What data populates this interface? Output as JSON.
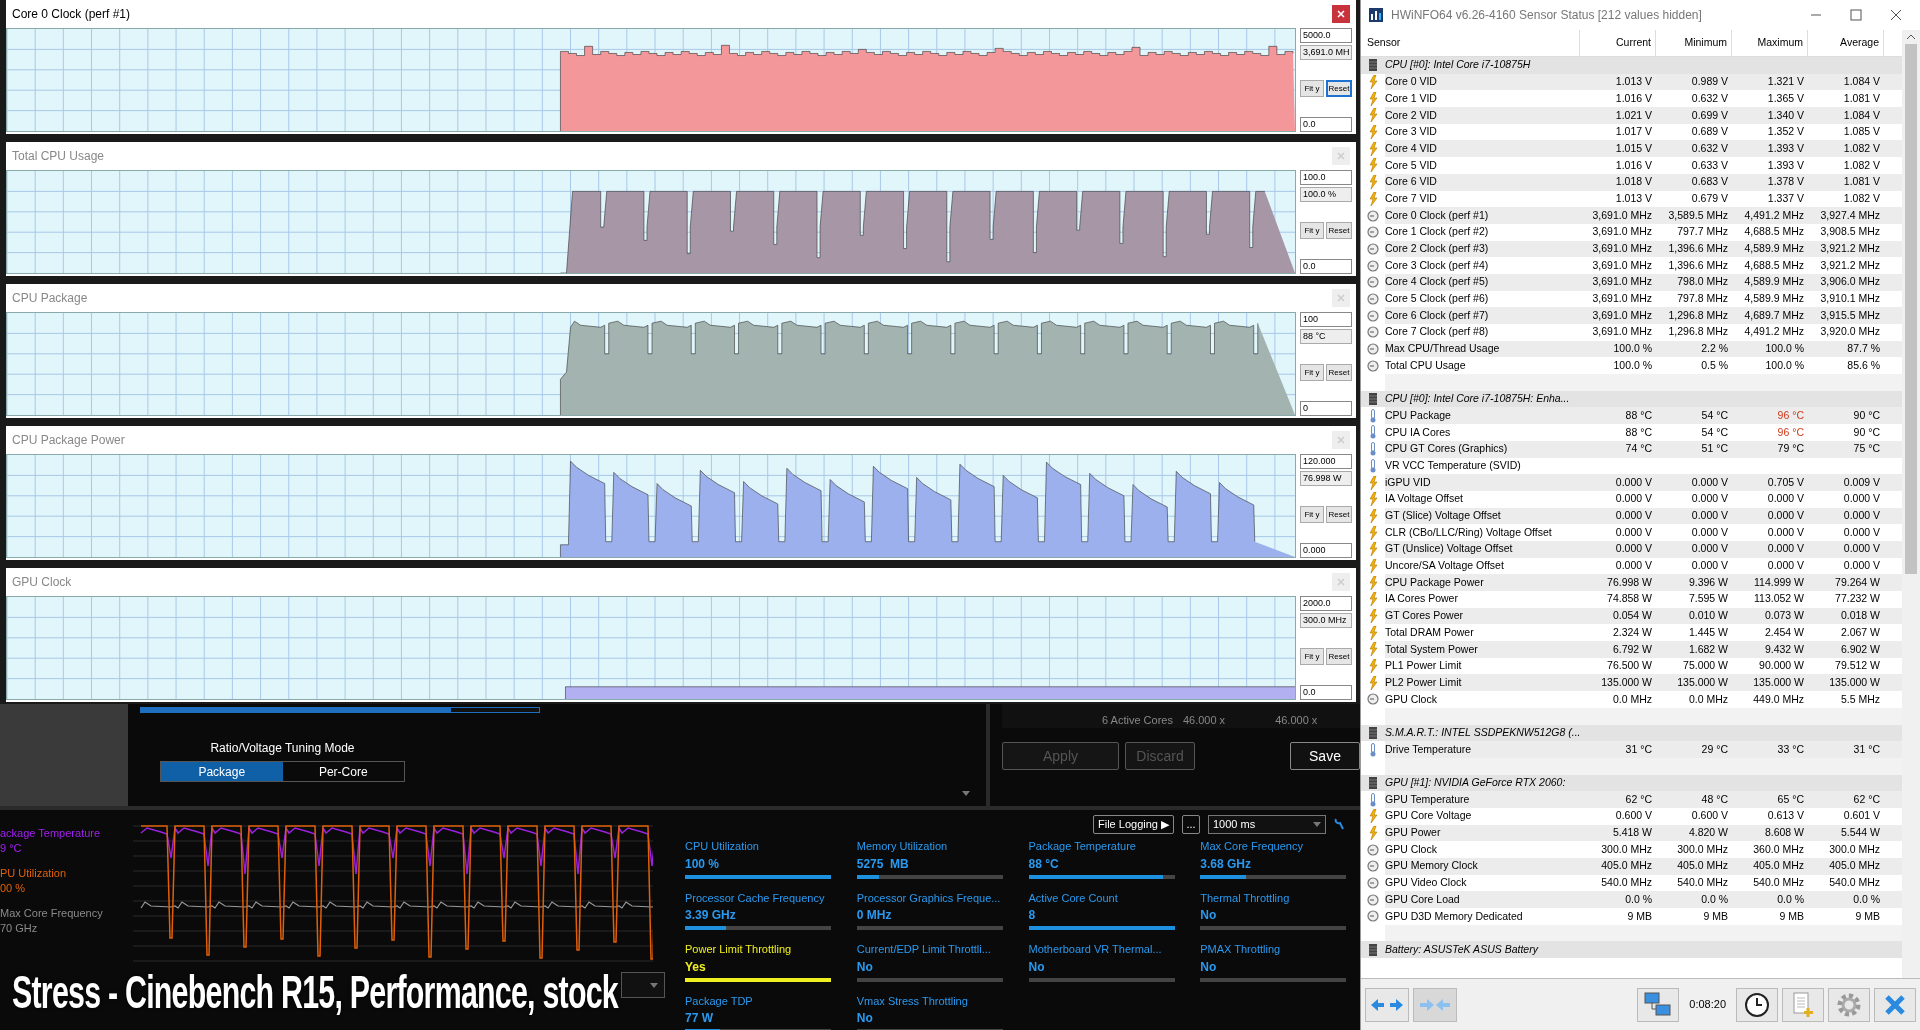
{
  "graph_windows": [
    {
      "title": "Core 0 Clock (perf #1)",
      "kind": "steady",
      "color": "#f4979a",
      "max": "5000.0",
      "reading": "3,691.0 MH",
      "min": "0.0",
      "active": true,
      "fit_label": "Fit y",
      "reset_label": "Reset"
    },
    {
      "title": "Total CPU Usage",
      "kind": "square",
      "color": "#a797a6",
      "max": "100.0",
      "reading": "100.0 %",
      "min": "0.0",
      "active": false,
      "fit_label": "Fit y",
      "reset_label": "Reset"
    },
    {
      "title": "CPU Package",
      "kind": "plateau",
      "color": "#a3b3b0",
      "max": "100",
      "reading": "88 °C",
      "min": "0",
      "active": false,
      "fit_label": "Fit y",
      "reset_label": "Reset"
    },
    {
      "title": "CPU Package Power",
      "kind": "saw",
      "color": "#9cb0ee",
      "max": "120.000",
      "reading": "76.998 W",
      "min": "0.000",
      "active": false,
      "fit_label": "Fit y",
      "reset_label": "Reset"
    },
    {
      "title": "GPU Clock",
      "kind": "flat",
      "color": "#b2b0f0",
      "max": "2000.0",
      "reading": "300.0 MHz",
      "min": "0.0",
      "active": false,
      "fit_label": "Fit y",
      "reset_label": "Reset"
    }
  ],
  "xtu": {
    "progress": {
      "level": 0.78
    },
    "tuning_mode": {
      "label": "Ratio/Voltage Tuning Mode",
      "options": [
        {
          "label": "Package",
          "selected": true
        },
        {
          "label": "Per-Core",
          "selected": false
        }
      ]
    },
    "active_cores": {
      "label": "6 Active Cores",
      "values": [
        "46.000 x",
        "46.000 x"
      ]
    },
    "buttons": [
      {
        "label": "Apply",
        "disabled": true
      },
      {
        "label": "Discard",
        "disabled": true
      },
      {
        "label": "Save",
        "disabled": false
      }
    ],
    "legend": [
      {
        "label": "ackage Temperature",
        "value": "9 °C",
        "color": "#a020f0"
      },
      {
        "label": "PU Utilization",
        "value": "00 %",
        "color": "#e0600a"
      },
      {
        "label": "Max Core Frequency",
        "value": "70 GHz",
        "color": "#8a8a8a"
      }
    ],
    "file_logging": "File Logging ▶",
    "more": "...",
    "interval": "1000 ms",
    "metrics": [
      {
        "label": "CPU Utilization",
        "value": "100 %",
        "level": 1.0,
        "alert": false
      },
      {
        "label": "Memory Utilization",
        "value": "5275  MB",
        "level": 0.15,
        "alert": false
      },
      {
        "label": "Package Temperature",
        "value": "88 °C",
        "level": 0.92,
        "alert": false
      },
      {
        "label": "Max Core Frequency",
        "value": "3.68 GHz",
        "level": 0.31,
        "alert": false
      },
      {
        "label": "Processor Cache Frequency",
        "value": "3.39 GHz",
        "level": 0.28,
        "alert": false
      },
      {
        "label": "Processor Graphics Freque...",
        "value": "0 MHz",
        "level": 0,
        "alert": false
      },
      {
        "label": "Active Core Count",
        "value": "8",
        "level": 1.0,
        "alert": false
      },
      {
        "label": "Thermal Throttling",
        "value": "No",
        "level": 0,
        "alert": false
      },
      {
        "label": "Power Limit Throttling",
        "value": "Yes",
        "level": 1.0,
        "alert": true
      },
      {
        "label": "Current/EDP Limit Throttli...",
        "value": "No",
        "level": 0,
        "alert": false
      },
      {
        "label": "Motherboard VR Thermal...",
        "value": "No",
        "level": 0,
        "alert": false
      },
      {
        "label": "PMAX Throttling",
        "value": "No",
        "level": 0,
        "alert": false
      },
      {
        "label": "Package TDP",
        "value": "77 W",
        "level": 0.24,
        "alert": false
      },
      {
        "label": "Vmax Stress Throttling",
        "value": "No",
        "level": 0,
        "alert": false
      }
    ]
  },
  "caption": "Stress - Cinebench R15, Performance, stock",
  "sensor_window": {
    "title": "HWiNFO64 v6.26-4160 Sensor Status [212 values hidden]",
    "columns": [
      "Sensor",
      "Current",
      "Minimum",
      "Maximum",
      "Average"
    ],
    "rows": [
      {
        "kind": "group",
        "name": "CPU [#0]: Intel Core i7-10875H"
      },
      {
        "kind": "voltage",
        "name": "Core 0 VID",
        "values": [
          "1.013 V",
          "0.989 V",
          "1.321 V",
          "1.084 V"
        ]
      },
      {
        "kind": "voltage",
        "name": "Core 1 VID",
        "values": [
          "1.016 V",
          "0.632 V",
          "1.365 V",
          "1.081 V"
        ]
      },
      {
        "kind": "voltage",
        "name": "Core 2 VID",
        "values": [
          "1.021 V",
          "0.699 V",
          "1.340 V",
          "1.084 V"
        ]
      },
      {
        "kind": "voltage",
        "name": "Core 3 VID",
        "values": [
          "1.017 V",
          "0.689 V",
          "1.352 V",
          "1.085 V"
        ]
      },
      {
        "kind": "voltage",
        "name": "Core 4 VID",
        "values": [
          "1.015 V",
          "0.632 V",
          "1.393 V",
          "1.082 V"
        ]
      },
      {
        "kind": "voltage",
        "name": "Core 5 VID",
        "values": [
          "1.016 V",
          "0.633 V",
          "1.393 V",
          "1.082 V"
        ]
      },
      {
        "kind": "voltage",
        "name": "Core 6 VID",
        "values": [
          "1.018 V",
          "0.683 V",
          "1.378 V",
          "1.081 V"
        ]
      },
      {
        "kind": "voltage",
        "name": "Core 7 VID",
        "values": [
          "1.013 V",
          "0.679 V",
          "1.337 V",
          "1.082 V"
        ]
      },
      {
        "kind": "clock",
        "name": "Core 0 Clock (perf #1)",
        "values": [
          "3,691.0 MHz",
          "3,589.5 MHz",
          "4,491.2 MHz",
          "3,927.4 MHz"
        ]
      },
      {
        "kind": "clock",
        "name": "Core 1 Clock (perf #2)",
        "values": [
          "3,691.0 MHz",
          "797.7 MHz",
          "4,688.5 MHz",
          "3,908.5 MHz"
        ]
      },
      {
        "kind": "clock",
        "name": "Core 2 Clock (perf #3)",
        "values": [
          "3,691.0 MHz",
          "1,396.6 MHz",
          "4,589.9 MHz",
          "3,921.2 MHz"
        ]
      },
      {
        "kind": "clock",
        "name": "Core 3 Clock (perf #4)",
        "values": [
          "3,691.0 MHz",
          "1,396.6 MHz",
          "4,688.5 MHz",
          "3,921.2 MHz"
        ]
      },
      {
        "kind": "clock",
        "name": "Core 4 Clock (perf #5)",
        "values": [
          "3,691.0 MHz",
          "798.0 MHz",
          "4,589.9 MHz",
          "3,906.0 MHz"
        ]
      },
      {
        "kind": "clock",
        "name": "Core 5 Clock (perf #6)",
        "values": [
          "3,691.0 MHz",
          "797.8 MHz",
          "4,589.9 MHz",
          "3,910.1 MHz"
        ]
      },
      {
        "kind": "clock",
        "name": "Core 6 Clock (perf #7)",
        "values": [
          "3,691.0 MHz",
          "1,296.8 MHz",
          "4,689.7 MHz",
          "3,915.5 MHz"
        ]
      },
      {
        "kind": "clock",
        "name": "Core 7 Clock (perf #8)",
        "values": [
          "3,691.0 MHz",
          "1,296.8 MHz",
          "4,491.2 MHz",
          "3,920.0 MHz"
        ]
      },
      {
        "kind": "clock",
        "name": "Max CPU/Thread Usage",
        "values": [
          "100.0 %",
          "2.2 %",
          "100.0 %",
          "87.7 %"
        ]
      },
      {
        "kind": "clock",
        "name": "Total CPU Usage",
        "values": [
          "100.0 %",
          "0.5 %",
          "100.0 %",
          "85.6 %"
        ]
      },
      {
        "kind": "group",
        "name": "CPU [#0]: Intel Core i7-10875H: Enha..."
      },
      {
        "kind": "temperature",
        "name": "CPU Package",
        "values": [
          "88 °C",
          "54 °C",
          "96 °C",
          "90 °C"
        ],
        "alert": true
      },
      {
        "kind": "temperature",
        "name": "CPU IA Cores",
        "values": [
          "88 °C",
          "54 °C",
          "96 °C",
          "90 °C"
        ],
        "alert": true
      },
      {
        "kind": "temperature",
        "name": "CPU GT Cores (Graphics)",
        "values": [
          "74 °C",
          "51 °C",
          "79 °C",
          "75 °C"
        ]
      },
      {
        "kind": "temperature",
        "name": "VR VCC Temperature (SVID)",
        "values": []
      },
      {
        "kind": "voltage",
        "name": "iGPU VID",
        "values": [
          "0.000 V",
          "0.000 V",
          "0.705 V",
          "0.009 V"
        ]
      },
      {
        "kind": "voltage",
        "name": "IA Voltage Offset",
        "values": [
          "0.000 V",
          "0.000 V",
          "0.000 V",
          "0.000 V"
        ]
      },
      {
        "kind": "voltage",
        "name": "GT (Slice) Voltage Offset",
        "values": [
          "0.000 V",
          "0.000 V",
          "0.000 V",
          "0.000 V"
        ]
      },
      {
        "kind": "voltage",
        "name": "CLR (CBo/LLC/Ring) Voltage Offset",
        "values": [
          "0.000 V",
          "0.000 V",
          "0.000 V",
          "0.000 V"
        ]
      },
      {
        "kind": "voltage",
        "name": "GT (Unslice) Voltage Offset",
        "values": [
          "0.000 V",
          "0.000 V",
          "0.000 V",
          "0.000 V"
        ]
      },
      {
        "kind": "voltage",
        "name": "Uncore/SA Voltage Offset",
        "values": [
          "0.000 V",
          "0.000 V",
          "0.000 V",
          "0.000 V"
        ]
      },
      {
        "kind": "voltage",
        "name": "CPU Package Power",
        "values": [
          "76.998 W",
          "9.396 W",
          "114.999 W",
          "79.264 W"
        ]
      },
      {
        "kind": "voltage",
        "name": "IA Cores Power",
        "values": [
          "74.858 W",
          "7.595 W",
          "113.052 W",
          "77.232 W"
        ]
      },
      {
        "kind": "voltage",
        "name": "GT Cores Power",
        "values": [
          "0.054 W",
          "0.010 W",
          "0.073 W",
          "0.018 W"
        ]
      },
      {
        "kind": "voltage",
        "name": "Total DRAM Power",
        "values": [
          "2.324 W",
          "1.445 W",
          "2.454 W",
          "2.067 W"
        ]
      },
      {
        "kind": "voltage",
        "name": "Total System Power",
        "values": [
          "6.792 W",
          "1.682 W",
          "9.432 W",
          "6.902 W"
        ]
      },
      {
        "kind": "voltage",
        "name": "PL1 Power Limit",
        "values": [
          "76.500 W",
          "75.000 W",
          "90.000 W",
          "79.512 W"
        ]
      },
      {
        "kind": "voltage",
        "name": "PL2 Power Limit",
        "values": [
          "135.000 W",
          "135.000 W",
          "135.000 W",
          "135.000 W"
        ]
      },
      {
        "kind": "clock",
        "name": "GPU Clock",
        "values": [
          "0.0 MHz",
          "0.0 MHz",
          "449.0 MHz",
          "5.5 MHz"
        ]
      },
      {
        "kind": "group",
        "name": "S.M.A.R.T.: INTEL SSDPEKNW512G8 (..."
      },
      {
        "kind": "temperature",
        "name": "Drive Temperature",
        "values": [
          "31 °C",
          "29 °C",
          "33 °C",
          "31 °C"
        ]
      },
      {
        "kind": "group",
        "name": "GPU [#1]: NVIDIA GeForce RTX 2060:"
      },
      {
        "kind": "temperature",
        "name": "GPU Temperature",
        "values": [
          "62 °C",
          "48 °C",
          "65 °C",
          "62 °C"
        ]
      },
      {
        "kind": "voltage",
        "name": "GPU Core Voltage",
        "values": [
          "0.600 V",
          "0.600 V",
          "0.613 V",
          "0.601 V"
        ]
      },
      {
        "kind": "voltage",
        "name": "GPU Power",
        "values": [
          "5.418 W",
          "4.820 W",
          "8.608 W",
          "5.544 W"
        ]
      },
      {
        "kind": "clock",
        "name": "GPU Clock",
        "values": [
          "300.0 MHz",
          "300.0 MHz",
          "360.0 MHz",
          "300.0 MHz"
        ]
      },
      {
        "kind": "clock",
        "name": "GPU Memory Clock",
        "values": [
          "405.0 MHz",
          "405.0 MHz",
          "405.0 MHz",
          "405.0 MHz"
        ]
      },
      {
        "kind": "clock",
        "name": "GPU Video Clock",
        "values": [
          "540.0 MHz",
          "540.0 MHz",
          "540.0 MHz",
          "540.0 MHz"
        ]
      },
      {
        "kind": "clock",
        "name": "GPU Core Load",
        "values": [
          "0.0 %",
          "0.0 %",
          "0.0 %",
          "0.0 %"
        ]
      },
      {
        "kind": "clock",
        "name": "GPU D3D Memory Dedicated",
        "values": [
          "9 MB",
          "9 MB",
          "9 MB",
          "9 MB"
        ]
      },
      {
        "kind": "group",
        "name": "Battery: ASUSTeK ASUS Battery"
      }
    ],
    "timer": "0:08:20"
  }
}
